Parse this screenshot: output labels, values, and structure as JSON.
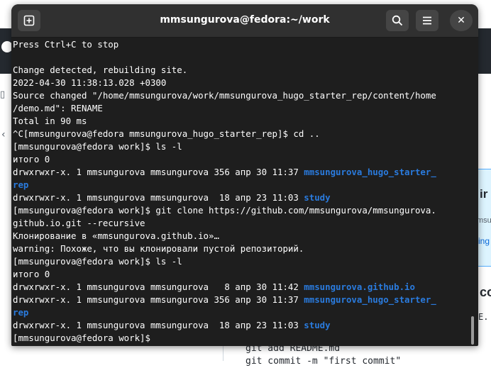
{
  "window": {
    "title": "mmsungurova@fedora:~/work",
    "new_tab_icon": "plus-square-icon",
    "search_icon": "search-icon",
    "menu_icon": "hamburger-menu-icon",
    "close_label": "✕"
  },
  "terminal": {
    "lines": [
      {
        "segments": [
          {
            "text": "Press Ctrl+C to stop"
          }
        ]
      },
      {
        "segments": [
          {
            "text": ""
          }
        ]
      },
      {
        "segments": [
          {
            "text": "Change detected, rebuilding site."
          }
        ]
      },
      {
        "segments": [
          {
            "text": "2022-04-30 11:38:13.028 +0300"
          }
        ]
      },
      {
        "segments": [
          {
            "text": "Source changed \"/home/mmsungurova/work/mmsungurova_hugo_starter_rep/content/home"
          }
        ]
      },
      {
        "segments": [
          {
            "text": "/demo.md\": RENAME"
          }
        ]
      },
      {
        "segments": [
          {
            "text": "Total in 90 ms"
          }
        ]
      },
      {
        "segments": [
          {
            "text": "^C[mmsungurova@fedora mmsungurova_hugo_starter_rep]$ cd .."
          }
        ]
      },
      {
        "segments": [
          {
            "text": "[mmsungurova@fedora work]$ ls -l"
          }
        ]
      },
      {
        "segments": [
          {
            "text": "итого 0"
          }
        ]
      },
      {
        "segments": [
          {
            "text": "drwxrwxr-x. 1 mmsungurova mmsungurova 356 апр 30 11:37 "
          },
          {
            "text": "mmsungurova_hugo_starter_",
            "link": true
          }
        ]
      },
      {
        "segments": [
          {
            "text": "rep",
            "link": true
          }
        ]
      },
      {
        "segments": [
          {
            "text": "drwxrwxr-x. 1 mmsungurova mmsungurova  18 апр 23 11:03 "
          },
          {
            "text": "study",
            "link": true
          }
        ]
      },
      {
        "segments": [
          {
            "text": "[mmsungurova@fedora work]$ git clone https://github.com/mmsungurova/mmsungurova."
          }
        ]
      },
      {
        "segments": [
          {
            "text": "github.io.git --recursive"
          }
        ]
      },
      {
        "segments": [
          {
            "text": "Клонирование в «mmsungurova.github.io»…"
          }
        ]
      },
      {
        "segments": [
          {
            "text": "warning: Похоже, что вы клонировали пустой репозиторий."
          }
        ]
      },
      {
        "segments": [
          {
            "text": "[mmsungurova@fedora work]$ ls -l"
          }
        ]
      },
      {
        "segments": [
          {
            "text": "итого 0"
          }
        ]
      },
      {
        "segments": [
          {
            "text": "drwxrwxr-x. 1 mmsungurova mmsungurova   8 апр 30 11:42 "
          },
          {
            "text": "mmsungurova.github.io",
            "link": true
          }
        ]
      },
      {
        "segments": [
          {
            "text": "drwxrwxr-x. 1 mmsungurova mmsungurova 356 апр 30 11:37 "
          },
          {
            "text": "mmsungurova_hugo_starter_",
            "link": true
          }
        ]
      },
      {
        "segments": [
          {
            "text": "rep",
            "link": true
          }
        ]
      },
      {
        "segments": [
          {
            "text": "drwxrwxr-x. 1 mmsungurova mmsungurova  18 апр 23 11:03 "
          },
          {
            "text": "study",
            "link": true
          }
        ]
      },
      {
        "segments": [
          {
            "text": "[mmsungurova@fedora work]$ "
          }
        ]
      }
    ]
  },
  "background": {
    "right_fragments": [
      "ir",
      "msu",
      "ing",
      "co",
      "E."
    ],
    "code_lines": [
      "git add README.md",
      "git commit -m \"first commit\""
    ]
  },
  "colors": {
    "terminal_bg": "#1e1e1e",
    "titlebar_bg": "#303030",
    "link_blue": "#2a7bde"
  }
}
